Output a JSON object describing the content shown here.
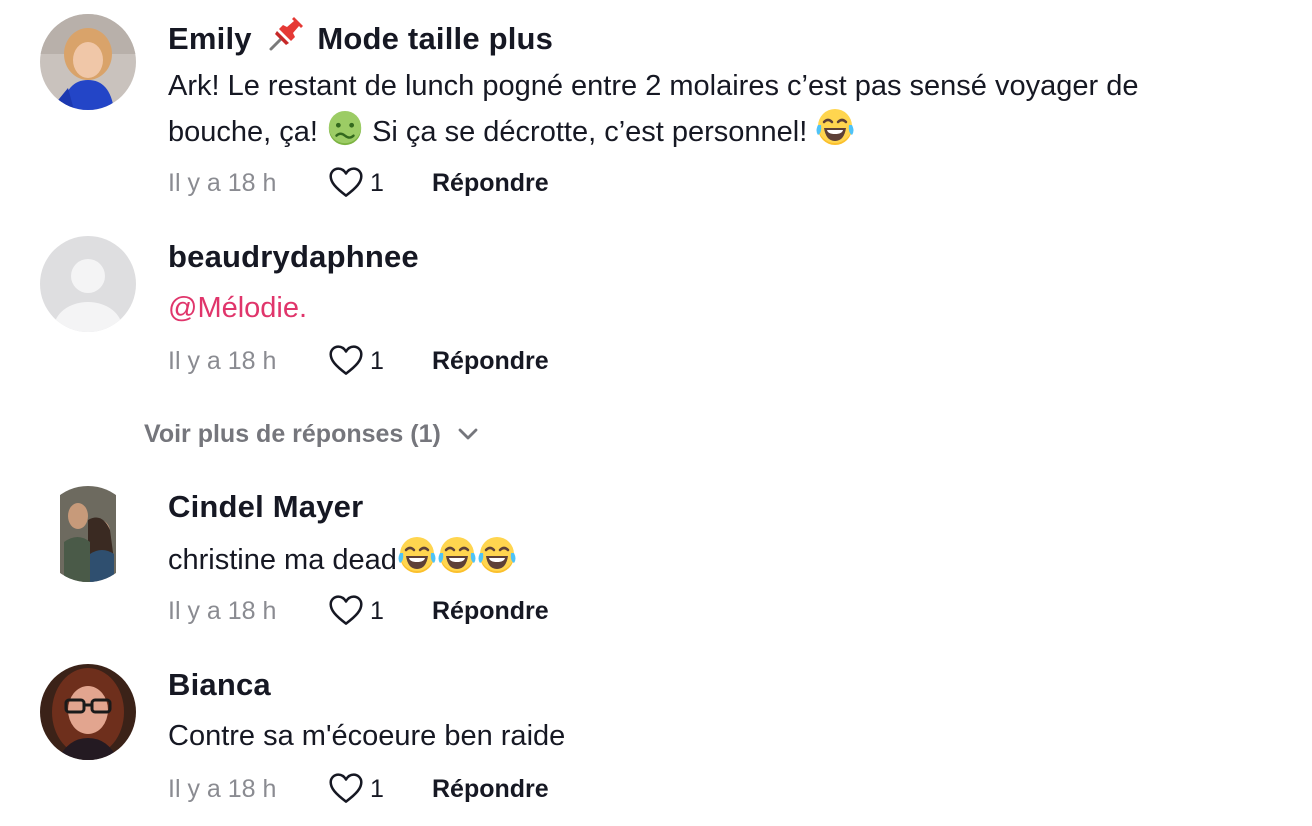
{
  "comments": [
    {
      "username": "Emily",
      "username_suffix": "Mode taille plus",
      "text_line1": "Ark! Le restant de lunch pogné entre 2 molaires c’est pas sensé voyager de",
      "text_line2a": "bouche, ça!",
      "text_line2b": "Si ça se décrotte, c’est personnel!",
      "time": "Il y a 18 h",
      "likes": "1",
      "reply_label": "Répondre"
    },
    {
      "username": "beaudrydaphnee",
      "mention": "@Mélodie.",
      "time": "Il y a 18 h",
      "likes": "1",
      "reply_label": "Répondre"
    },
    {
      "username": "Cindel Mayer",
      "text": "christine ma dead",
      "time": "Il y a 18 h",
      "likes": "1",
      "reply_label": "Répondre"
    },
    {
      "username": "Bianca",
      "text": "Contre sa m'écoeure ben raide",
      "time": "Il y a 18 h",
      "likes": "1",
      "reply_label": "Répondre"
    }
  ],
  "more_replies_label": "Voir plus de réponses (1)",
  "icons": {
    "pin": "pushpin-icon",
    "nauseated": "nauseated-face-emoji",
    "laughing": "tears-of-joy-emoji",
    "heart": "heart-outline-icon",
    "chevron": "chevron-down-icon"
  },
  "colors": {
    "text": "#161823",
    "muted": "#8a8b91",
    "mention": "#e0356b"
  }
}
